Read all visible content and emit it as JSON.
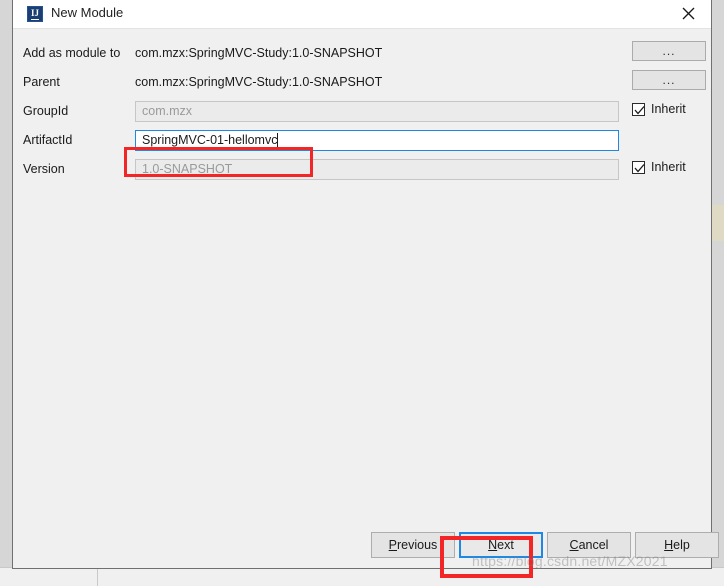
{
  "window": {
    "title": "New Module",
    "app_icon": "intellij-idea-icon",
    "icon_glyph": "IJ",
    "close_icon": "close-icon"
  },
  "form": {
    "rows": [
      {
        "label": "Add as module to",
        "type": "static",
        "value": "com.mzx:SpringMVC-Study:1.0-SNAPSHOT",
        "button": "...",
        "name": "add-as-module-to"
      },
      {
        "label": "Parent",
        "type": "static",
        "value": "com.mzx:SpringMVC-Study:1.0-SNAPSHOT",
        "button": "...",
        "name": "parent"
      },
      {
        "label": "GroupId",
        "type": "input-disabled",
        "value": "com.mzx",
        "inherit_label": "Inherit",
        "inherit_checked": true,
        "name": "groupid"
      },
      {
        "label": "ArtifactId",
        "type": "input-focused",
        "value": "SpringMVC-01-hellomvc",
        "name": "artifactid"
      },
      {
        "label": "Version",
        "type": "input-disabled",
        "value": "1.0-SNAPSHOT",
        "inherit_label": "Inherit",
        "inherit_checked": true,
        "name": "version"
      }
    ]
  },
  "footer": {
    "previous": {
      "label": "Previous",
      "mnemonic": "P",
      "rest": "revious"
    },
    "next": {
      "label": "Next",
      "mnemonic": "N",
      "rest": "ext"
    },
    "cancel": {
      "label": "Cancel",
      "mnemonic": "C",
      "rest": "ancel"
    },
    "help": {
      "label": "Help",
      "mnemonic": "H",
      "rest": "elp"
    }
  },
  "annotations": {
    "artifact_highlight_color": "#f22626",
    "next_highlight_color": "#f22626",
    "focus_color": "#1e88e5"
  },
  "watermark": {
    "text": "https://blog.csdn.net/MZX2021"
  }
}
